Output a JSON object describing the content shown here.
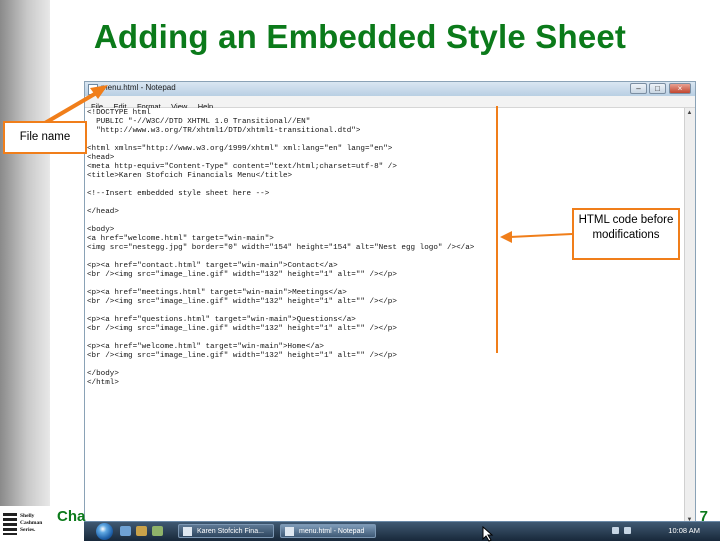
{
  "slide": {
    "title": "Adding an Embedded Style Sheet",
    "footer_chapter": "Cha",
    "footer_page": "7",
    "logo_text": "Shelly Cashman Series."
  },
  "window": {
    "title": "menu.html - Notepad",
    "menu": [
      "File",
      "Edit",
      "Format",
      "View",
      "Help"
    ],
    "controls": {
      "minimize": "–",
      "maximize": "□",
      "close": "×"
    },
    "code_lines": [
      "<!DOCTYPE html",
      "  PUBLIC \"-//W3C//DTD XHTML 1.0 Transitional//EN\"",
      "  \"http://www.w3.org/TR/xhtml1/DTD/xhtml1-transitional.dtd\">",
      "",
      "<html xmlns=\"http://www.w3.org/1999/xhtml\" xml:lang=\"en\" lang=\"en\">",
      "<head>",
      "<meta http-equiv=\"Content-Type\" content=\"text/html;charset=utf-8\" />",
      "<title>Karen Stofcich Financials Menu</title>",
      "",
      "<!--Insert embedded style sheet here -->",
      "",
      "</head>",
      "",
      "<body>",
      "<a href=\"welcome.html\" target=\"win-main\">",
      "<img src=\"nestegg.jpg\" border=\"0\" width=\"154\" height=\"154\" alt=\"Nest egg logo\" /></a>",
      "",
      "<p><a href=\"contact.html\" target=\"win-main\">Contact</a>",
      "<br /><img src=\"image_line.gif\" width=\"132\" height=\"1\" alt=\"\" /></p>",
      "",
      "<p><a href=\"meetings.html\" target=\"win-main\">Meetings</a>",
      "<br /><img src=\"image_line.gif\" width=\"132\" height=\"1\" alt=\"\" /></p>",
      "",
      "<p><a href=\"questions.html\" target=\"win-main\">Questions</a>",
      "<br /><img src=\"image_line.gif\" width=\"132\" height=\"1\" alt=\"\" /></p>",
      "",
      "<p><a href=\"welcome.html\" target=\"win-main\">Home</a>",
      "<br /><img src=\"image_line.gif\" width=\"132\" height=\"1\" alt=\"\" /></p>",
      "",
      "</body>",
      "</html>"
    ]
  },
  "callouts": {
    "file_name": "File name",
    "html_code": "HTML code before modifications"
  },
  "taskbar": {
    "items": [
      "Karen Stofcich Fina...",
      "menu.html - Notepad"
    ],
    "clock": "10:08 AM"
  },
  "icons": [
    "windows-start-icon",
    "notepad-doc-icon",
    "ie-icon",
    "folder-icon",
    "mouse-cursor-icon"
  ],
  "colors": {
    "title_green": "#0b7a1a",
    "callout_orange": "#f07e1a"
  }
}
